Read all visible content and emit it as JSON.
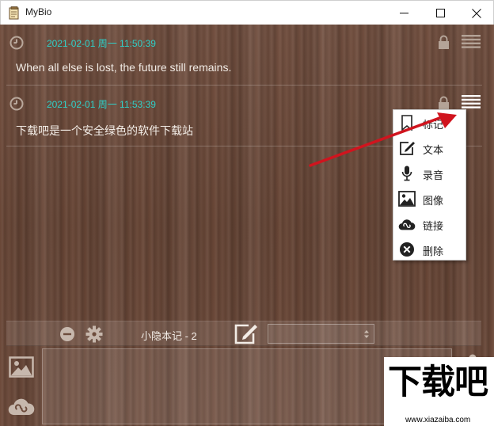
{
  "window": {
    "title": "MyBio",
    "controls": [
      "minimize-icon",
      "maximize-icon",
      "close-icon"
    ]
  },
  "notes": [
    {
      "time": "2021-02-01 周一 11:50:39",
      "text": "When all else is lost, the future still remains."
    },
    {
      "time": "2021-02-01 周一 11:53:39",
      "text": "下载吧是一个安全绿色的软件下载站"
    }
  ],
  "context_menu": {
    "items": [
      {
        "label": "标记",
        "icon": "bookmark-icon"
      },
      {
        "label": "文本",
        "icon": "edit-icon"
      },
      {
        "label": "录音",
        "icon": "microphone-icon"
      },
      {
        "label": "图像",
        "icon": "image-icon"
      },
      {
        "label": "链接",
        "icon": "link-cloud-icon"
      },
      {
        "label": "删除",
        "icon": "delete-icon"
      }
    ]
  },
  "toolbar": {
    "notebook_title": "小隐本记 - 2",
    "select_value": ""
  },
  "input": {
    "value": "",
    "placeholder": ""
  },
  "watermark": {
    "main": "下载吧",
    "sub": "www.xiazaiba.com"
  },
  "colors": {
    "wood": "#6b4a3a",
    "timestamp": "#2fd0c8",
    "note_text": "#f2ece6",
    "arrow": "#d0141e"
  }
}
